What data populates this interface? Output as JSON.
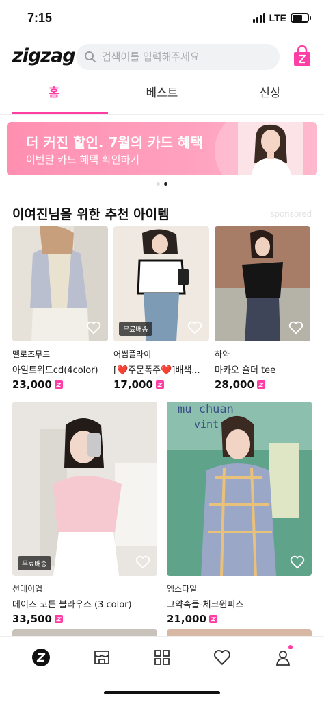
{
  "status": {
    "time": "7:15",
    "network": "LTE",
    "battery_level": 0.65
  },
  "header": {
    "logo": "zigzag",
    "search_placeholder": "검색어를 입력해주세요"
  },
  "tabs": [
    {
      "label": "홈",
      "active": true
    },
    {
      "label": "베스트",
      "active": false
    },
    {
      "label": "신상",
      "active": false
    }
  ],
  "banner": {
    "title": "더 커진 할인. 7월의 카드 혜택",
    "subtitle": "이번달 카드 혜택 확인하기"
  },
  "recommend": {
    "title": "이여진님을 위한 추천 아이템",
    "sponsored": "sponsored",
    "items": [
      {
        "shop": "멜로즈무드",
        "name": "아일트위드cd(4color)",
        "price": "23,000"
      },
      {
        "shop": "어썸플라이",
        "name": "[❤️주문폭주❤️]배색...",
        "price": "17,000",
        "badge": "무료배송"
      },
      {
        "shop": "하와",
        "name": "마카오 숄더 tee",
        "price": "28,000"
      }
    ]
  },
  "feed": [
    {
      "shop": "선데이업",
      "name": "데이즈 코튼 블라우스 (3 color)",
      "price": "33,500",
      "badge": "무료배송"
    },
    {
      "shop": "엠스타일",
      "name": "그약속들-체크원피스",
      "price": "21,000",
      "sign_text": "mu chuan\nvint"
    }
  ],
  "bottom_nav": [
    "home",
    "store",
    "category",
    "likes",
    "my"
  ],
  "colors": {
    "accent": "#ff3ea5",
    "banner": "#ff9bb9"
  }
}
